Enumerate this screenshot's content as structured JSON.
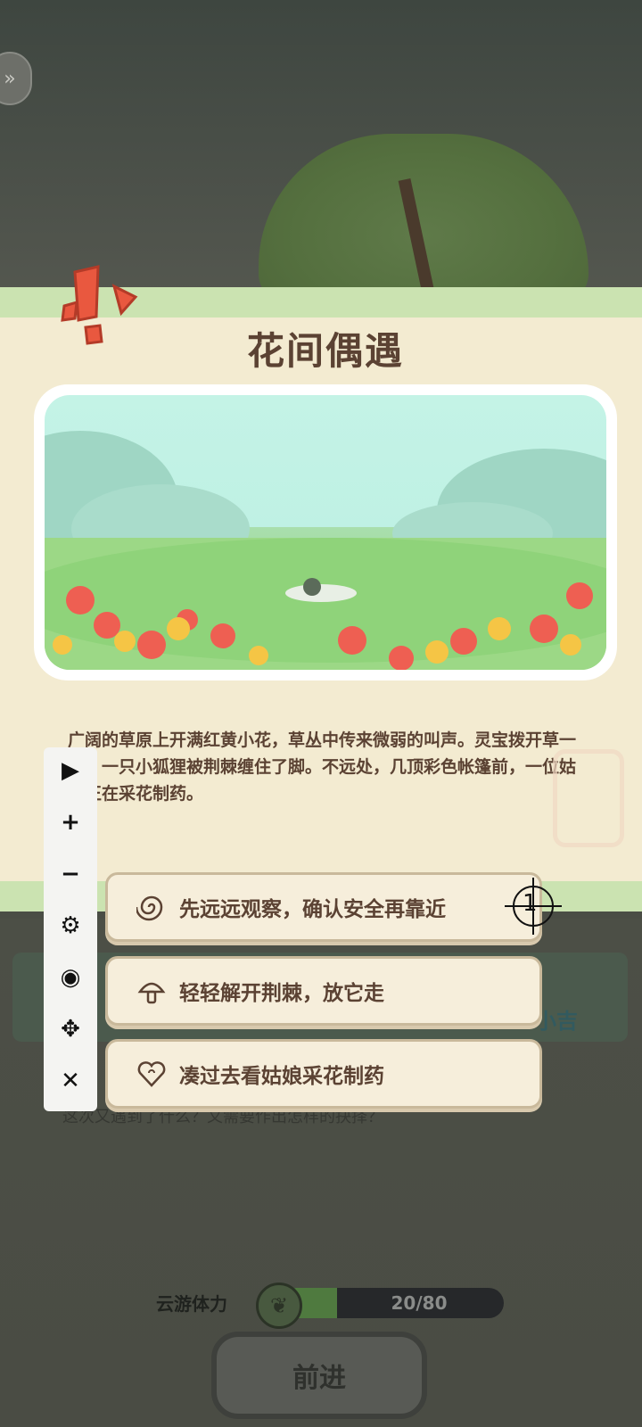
{
  "event": {
    "title": "花间偶遇",
    "description": "广阔的草原上开满红黄小花，草丛中传来微弱的叫声。灵宝拨开草一看，一只小狐狸被荆棘缠住了脚。不远处，几顶彩色帐篷前，一位姑娘正在采花制药。"
  },
  "choices": [
    {
      "label": "先远远观察，确认安全再靠近",
      "icon": "spiral-icon"
    },
    {
      "label": "轻轻解开荆棘，放它走",
      "icon": "mushroom-icon"
    },
    {
      "label": "凑过去看姑娘采花制药",
      "icon": "heart-swirl-icon"
    }
  ],
  "crosshair_label": "1",
  "background": {
    "luck_label": "小吉",
    "prompt": "这次又遇到了什么？又需要作出怎样的抉择？"
  },
  "stamina": {
    "label": "云游体力",
    "current": 20,
    "max": 80,
    "display": "20/80"
  },
  "advance_button": "前进",
  "toolbar": {
    "play": "▶",
    "zoom_in": "+",
    "zoom_out": "−",
    "settings": "⚙",
    "hide": "◉",
    "move": "✥",
    "close": "✕"
  },
  "colors": {
    "card_bg": "#f3ebd1",
    "card_border": "#cbe3b1",
    "text_brown": "#5b4233",
    "choice_border": "#c9b99b"
  }
}
